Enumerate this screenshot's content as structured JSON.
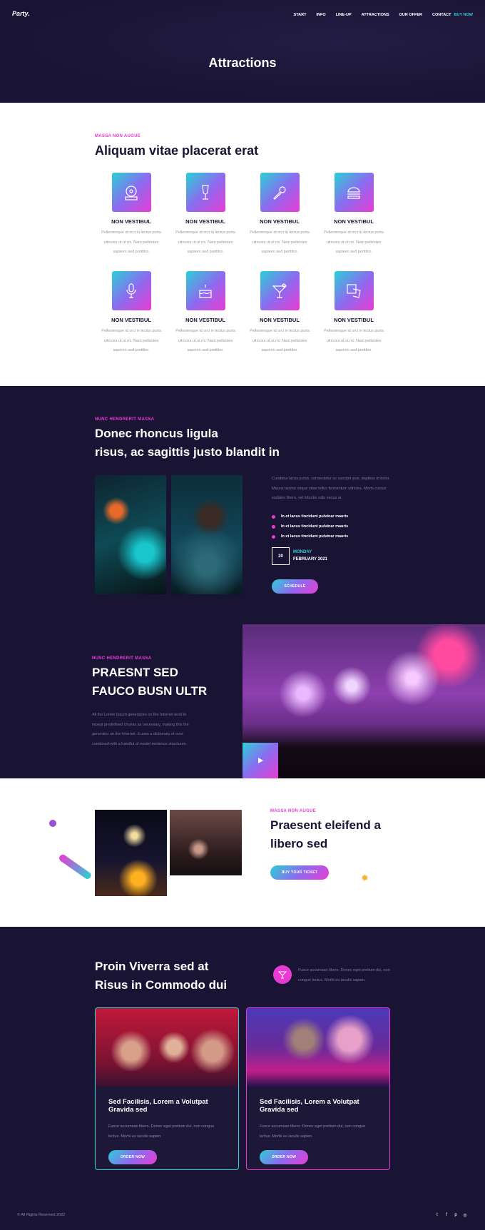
{
  "header": {
    "logo": "Party.",
    "nav": [
      "START",
      "INFO",
      "LINE-UP",
      "ATTRACTIONS",
      "OUR OFFER",
      "CONTACT"
    ],
    "buy": "BUY NOW",
    "title": "Attractions"
  },
  "features": {
    "eyebrow": "MASSA NON AUGUE",
    "title": "Aliquam vitae placerat erat",
    "items": [
      {
        "icon": "disc-icon",
        "title": "NON VESTIBUL",
        "desc": "Pellentesque id orci in lectus porta ultricies ut ut mi. Nam pellentes sapieen sed porttitor."
      },
      {
        "icon": "champagne-glass-icon",
        "title": "NON VESTIBUL",
        "desc": "Pellentesque id orci in lectus porta ultricies ut ut mi. Nam pellentes sapieen sed porttitor."
      },
      {
        "icon": "microphone-icon",
        "title": "NON VESTIBUL",
        "desc": "Pellentesque id orci in lectus porta ultricies ut ut mi. Nam pellentes sapieen sed porttitor."
      },
      {
        "icon": "burger-icon",
        "title": "NON VESTIBUL",
        "desc": "Pellentesque id orci in lectus porta ultricies ut ut mi. Nam pellentes sapieen sed porttitor."
      },
      {
        "icon": "studio-mic-icon",
        "title": "NON VESTIBUL",
        "desc": "Pellentesque id orci in lectus porta ultricies ut ut mi. Nam pellentes sapieen sed porttitor."
      },
      {
        "icon": "cake-icon",
        "title": "NON VESTIBUL",
        "desc": "Pellentesque id orci in lectus porta ultricies ut ut mi. Nam pellentes sapieen sed porttitor."
      },
      {
        "icon": "cocktail-icon",
        "title": "NON VESTIBUL",
        "desc": "Pellentesque id orci in lectus porta ultricies ut ut mi. Nam pellentes sapieen sed porttitor."
      },
      {
        "icon": "photos-icon",
        "title": "NON VESTIBUL",
        "desc": "Pellentesque id orci in lectus porta ultricies ut ut mi. Nam pellentes sapieen sed porttitor."
      }
    ]
  },
  "event": {
    "eyebrow": "NUNC HENDRERIT MASSA",
    "title1": "Donec rhoncus ligula",
    "title2": "risus, ac sagittis justo blandit in",
    "desc": "Curabitur lacus purus, consectetur ac suscipit quis, dapibus id dolor. Mauris lacinia neque vitae tellus fermentum ultricies. Morbi cursus sodales libero, vel lobortis odio varius at.",
    "bullets": [
      "In et lacus tincidunt pulvinar mauris",
      "In et lacus tincidunt pulvinar mauris",
      "In et lacus tincidunt pulvinar mauris"
    ],
    "day_num": "20",
    "day": "MONDAY",
    "month": "FEBRUARY 2021",
    "button": "SCHEDULE"
  },
  "video": {
    "eyebrow": "NUNC HENDRERIT MASSA",
    "title1": "PRAESNT SED",
    "title2": "FAUCO BUSN ULTR",
    "desc": "All the Lorem Ipsum generators on the Internet tend to repeat predefined chunks as necessary, making this the generator on the Internet. It uses a dictionary of over combined with a handful of model sentence structures."
  },
  "ticket": {
    "eyebrow": "MASSA NON AUGUE",
    "title1": "Praesent eleifend a",
    "title2": "libero sed",
    "button": "BUY YOUR TICKET"
  },
  "offers": {
    "title1": "Proin Viverra sed at",
    "title2": "Risus in Commodo dui",
    "side": "Fusce accumsan libero. Donec eget pretium dui, non congue lectus. Morbi eu iaculis sapien.",
    "cards": [
      {
        "title": "Sed Facilisis, Lorem a Volutpat Gravida sed",
        "desc": "Fusce accumsan libero. Donec eget pretium dui, non congue lectus. Morbi eu iaculis sapien.",
        "button": "ORDER NOW",
        "border": "#2ad1d6"
      },
      {
        "title": "Sed Facilisis, Lorem a Volutpat Gravida sed",
        "desc": "Fusce accumsan libero. Donec eget pretium dui, non congue lectus. Morbi eu iaculis sapien.",
        "button": "ORDER NOW",
        "border": "#e93bd3"
      }
    ]
  },
  "footer": {
    "copyright": "© All Rights Reserved 2022",
    "social": [
      "twitter-icon",
      "facebook-icon",
      "pinterest-icon",
      "instagram-icon"
    ]
  },
  "colors": {
    "dark": "#1a1434",
    "pink": "#e93bd3",
    "cyan": "#2ad1d6"
  }
}
